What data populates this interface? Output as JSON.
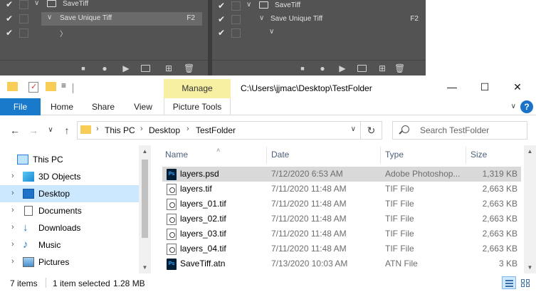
{
  "photoshop_actions": {
    "left_panel": {
      "set_name": "SaveTiff",
      "action_name": "Save Unique Tiff",
      "shortcut": "F2",
      "step_glyph": "〉"
    },
    "right_panel": {
      "set_name": "SaveTiff",
      "action_name": "Save Unique Tiff",
      "shortcut": "F2",
      "step_glyph": "∨"
    },
    "toolbar_icons": [
      "stop-icon",
      "record-icon",
      "play-icon",
      "new-set-folder-icon",
      "new-action-icon",
      "delete-icon"
    ],
    "toolbar_glyphs": {
      "stop": "■",
      "record": "●",
      "play": "▶",
      "folder": "🗀",
      "new": "⊞",
      "delete": "🗑"
    },
    "check_glyph": "✔"
  },
  "window": {
    "title": "C:\\Users\\jjmac\\Desktop\\TestFolder",
    "minimize_glyph": "—",
    "maximize_glyph": "☐",
    "close_glyph": "✕",
    "qat_dropdown_glyph": "≡"
  },
  "ribbon": {
    "tabs": {
      "file": "File",
      "home": "Home",
      "share": "Share",
      "view": "View",
      "picture_tools": "Picture Tools"
    },
    "contextual_header": "Manage",
    "contextual_color": "#f7f0a3",
    "expand_glyph": "∨",
    "help_glyph": "?"
  },
  "address_bar": {
    "back_glyph": "←",
    "forward_glyph": "→",
    "recent_glyph": "∨",
    "up_glyph": "↑",
    "separator_glyph": "›",
    "breadcrumbs": [
      "This PC",
      "Desktop",
      "TestFolder"
    ],
    "dropdown_glyph": "∨",
    "refresh_glyph": "↻"
  },
  "search": {
    "placeholder": "Search TestFolder"
  },
  "nav_pane": {
    "expand_glyph": "›",
    "items": [
      {
        "label": "This PC",
        "icon": "monitor-icon",
        "selected": false
      },
      {
        "label": "3D Objects",
        "icon": "3d-objects-icon",
        "selected": false
      },
      {
        "label": "Desktop",
        "icon": "desktop-icon",
        "selected": true
      },
      {
        "label": "Documents",
        "icon": "documents-icon",
        "selected": false
      },
      {
        "label": "Downloads",
        "icon": "downloads-icon",
        "selected": false
      },
      {
        "label": "Music",
        "icon": "music-icon",
        "selected": false
      },
      {
        "label": "Pictures",
        "icon": "pictures-icon",
        "selected": false
      }
    ],
    "selected_color": "#cce8ff"
  },
  "file_list": {
    "columns": {
      "name": "Name",
      "date": "Date",
      "type": "Type",
      "size": "Size"
    },
    "sort_glyph": "˄",
    "rows": [
      {
        "name": "layers.psd",
        "date": "7/12/2020 6:53 AM",
        "type": "Adobe Photoshop...",
        "size": "1,319 KB",
        "icon": "psd-file-icon",
        "selected": true
      },
      {
        "name": "layers.tif",
        "date": "7/11/2020 11:48 AM",
        "type": "TIF File",
        "size": "2,663 KB",
        "icon": "tif-file-icon",
        "selected": false
      },
      {
        "name": "layers_01.tif",
        "date": "7/11/2020 11:48 AM",
        "type": "TIF File",
        "size": "2,663 KB",
        "icon": "tif-file-icon",
        "selected": false
      },
      {
        "name": "layers_02.tif",
        "date": "7/11/2020 11:48 AM",
        "type": "TIF File",
        "size": "2,663 KB",
        "icon": "tif-file-icon",
        "selected": false
      },
      {
        "name": "layers_03.tif",
        "date": "7/11/2020 11:48 AM",
        "type": "TIF File",
        "size": "2,663 KB",
        "icon": "tif-file-icon",
        "selected": false
      },
      {
        "name": "layers_04.tif",
        "date": "7/11/2020 11:48 AM",
        "type": "TIF File",
        "size": "2,663 KB",
        "icon": "tif-file-icon",
        "selected": false
      },
      {
        "name": "SaveTiff.atn",
        "date": "7/13/2020 10:03 AM",
        "type": "ATN File",
        "size": "3 KB",
        "icon": "atn-file-icon",
        "selected": false
      }
    ],
    "ps_icon_text": "Ps"
  },
  "status_bar": {
    "item_count": "7 items",
    "selection": "1 item selected",
    "selection_size": "1.28 MB"
  }
}
